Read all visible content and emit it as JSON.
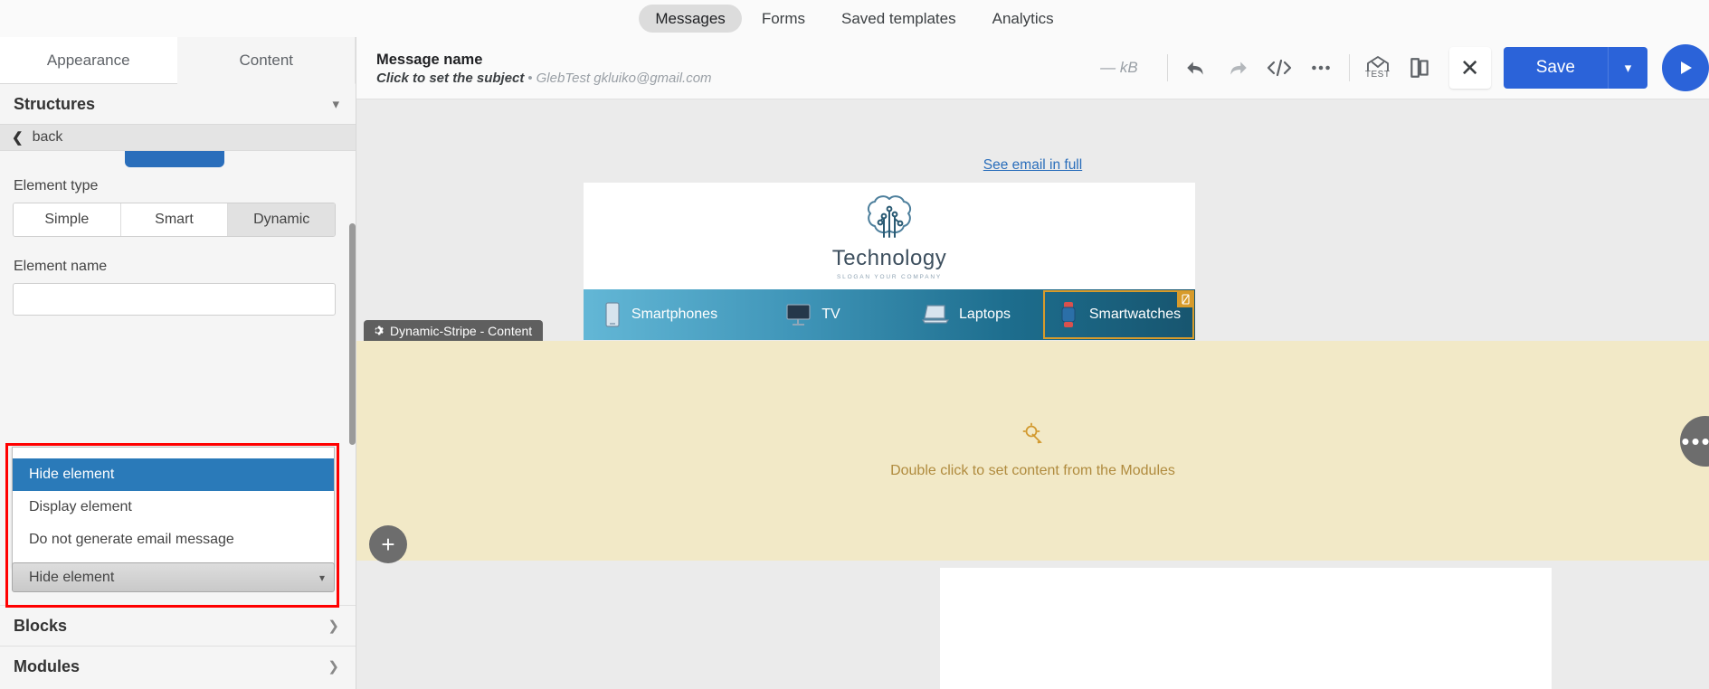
{
  "topnav": {
    "items": [
      {
        "label": "Messages",
        "active": true
      },
      {
        "label": "Forms",
        "active": false
      },
      {
        "label": "Saved templates",
        "active": false
      },
      {
        "label": "Analytics",
        "active": false
      }
    ]
  },
  "sidebar": {
    "tabs": [
      {
        "label": "Appearance",
        "active": false
      },
      {
        "label": "Content",
        "active": true
      }
    ],
    "structures_title": "Structures",
    "back_label": "back",
    "element_type_label": "Element type",
    "element_type_options": [
      {
        "label": "Simple",
        "active": false
      },
      {
        "label": "Smart",
        "active": false
      },
      {
        "label": "Dynamic",
        "active": true
      }
    ],
    "element_name_label": "Element name",
    "element_name_value": "",
    "element_name_placeholder": "",
    "dropdown": {
      "options": [
        "Hide element",
        "Display element",
        "Do not generate email message"
      ],
      "selected": "Hide element",
      "closed_value": "Hide element"
    },
    "sections": [
      {
        "label": "Blocks"
      },
      {
        "label": "Modules"
      }
    ]
  },
  "editor_header": {
    "message_name": "Message name",
    "subject_hint": "Click to set the subject",
    "separator": "•",
    "sender": "GlebTest gkluiko@gmail.com",
    "size": "— kB",
    "icons": [
      {
        "name": "undo-icon",
        "label": "Undo"
      },
      {
        "name": "redo-icon",
        "label": "Redo"
      },
      {
        "name": "code-icon",
        "label": "</>"
      },
      {
        "name": "more-options-icon",
        "label": "•••"
      },
      {
        "name": "test-message-icon",
        "label": "TEST"
      },
      {
        "name": "duplicate-icon",
        "label": "Duplicate"
      }
    ],
    "close_label": "✕",
    "save_label": "Save",
    "save_caret_label": "⌄",
    "play_label": "▶"
  },
  "canvas": {
    "see_full_link": "See email in full",
    "email": {
      "logo_brand": "Technology",
      "logo_slogan": "SLOGAN YOUR COMPANY",
      "nav": [
        {
          "label": "Smartphones",
          "icon": "smartphone-icon",
          "highlighted": false
        },
        {
          "label": "TV",
          "icon": "tv-icon",
          "highlighted": false
        },
        {
          "label": "Laptops",
          "icon": "laptop-icon",
          "highlighted": false
        },
        {
          "label": "Smartwatches",
          "icon": "smartwatch-icon",
          "highlighted": true
        }
      ]
    },
    "dynamic_tab_label": "Dynamic-Stripe - Content",
    "dynamic_hint": "Double click to set content from the Modules",
    "add_button_label": "+",
    "more_button_label": "•••"
  },
  "colors": {
    "accent_blue": "#2b63d9",
    "select_blue": "#2a7ab9",
    "highlight_red": "#ff0000",
    "gold": "#d79b2b",
    "dynamic_bg": "#f2e9c7"
  }
}
